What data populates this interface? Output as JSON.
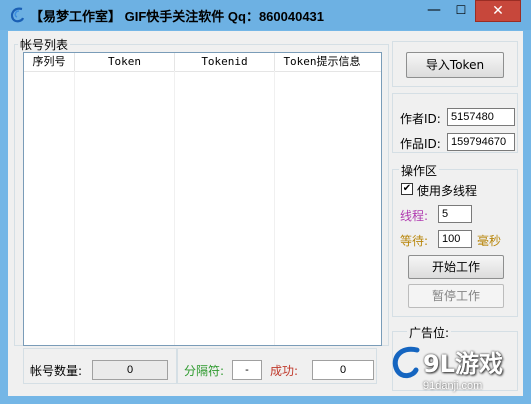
{
  "window": {
    "title": "【易梦工作室】 GIF快手关注软件  Qq：860040431",
    "min_glyph": "—",
    "max_glyph": "☐",
    "close_glyph": "✕"
  },
  "account_list": {
    "legend": "帐号列表",
    "columns": [
      "序列号",
      "Token",
      "Tokenid",
      "Token提示信息"
    ],
    "rows": []
  },
  "status_bar": {
    "count_label": "帐号数量:",
    "count_value": "0",
    "separator_label": "分隔符:",
    "separator_value": "-",
    "success_label": "成功:",
    "success_value": "0"
  },
  "right_panel": {
    "import_button": "导入Token",
    "author_id_label": "作者ID:",
    "author_id_value": "5157480",
    "work_id_label": "作品ID:",
    "work_id_value": "159794670",
    "ops_legend": "操作区",
    "multithread_checked": true,
    "multithread_label": "使用多线程",
    "threads_label": "线程:",
    "threads_value": "5",
    "wait_label": "等待:",
    "wait_value": "100",
    "wait_unit": "毫秒",
    "start_button": "开始工作",
    "pause_button": "暂停工作",
    "ad_legend": "广告位:"
  },
  "watermark": {
    "logo_text": "9L游戏",
    "url": "91danji.com"
  },
  "colors": {
    "title_bar": "#6db1e3",
    "close_button": "#c7473b",
    "separator_label": "#2e9a2e",
    "success_label": "#c0392b",
    "threads_label": "#b03ab0",
    "wait_label": "#b8860b"
  }
}
